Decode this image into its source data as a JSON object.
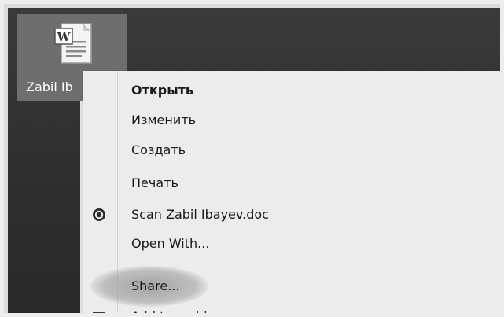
{
  "desktop": {
    "file_icon": {
      "label": "Zabil Ib",
      "icon": "word-document-icon"
    }
  },
  "context_menu": {
    "items": [
      {
        "label": "Открыть",
        "bold": true,
        "icon": ""
      },
      {
        "label": "Изменить",
        "bold": false,
        "icon": ""
      },
      {
        "label": "Создать",
        "bold": false,
        "icon": ""
      },
      {
        "label": "Печать",
        "bold": false,
        "icon": ""
      },
      {
        "label": "Scan Zabil Ibayev.doc",
        "bold": false,
        "icon": "antivirus-scan-icon"
      },
      {
        "label": "Open With...",
        "bold": false,
        "icon": ""
      },
      {
        "label": "Share...",
        "bold": false,
        "icon": ""
      },
      {
        "label": "Add to archive...",
        "bold": false,
        "icon": "archive-icon"
      }
    ]
  },
  "colors": {
    "menu_background": "#ececec",
    "desktop_background": "#333333",
    "selected_tile": "#6e6e6e"
  }
}
